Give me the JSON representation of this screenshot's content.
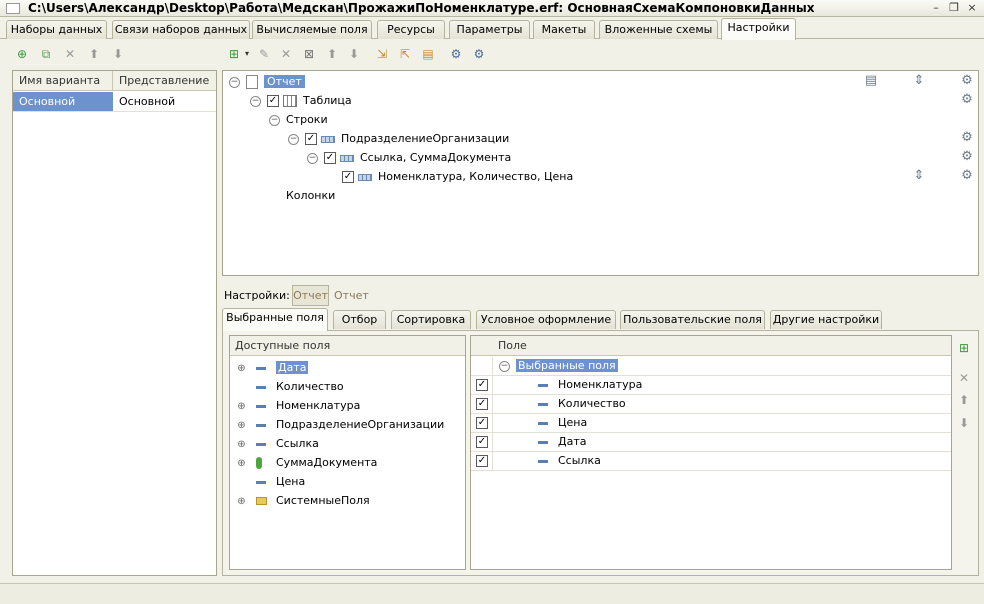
{
  "window": {
    "title": "C:\\Users\\Александр\\Desktop\\Работа\\Медскан\\ПрожажиПоНоменклатуре.erf: ОсновнаяСхемаКомпоновкиДанных",
    "minimize": "–",
    "restore": "❐",
    "close": "×"
  },
  "tabs": [
    "Наборы данных",
    "Связи наборов данных",
    "Вычисляемые поля",
    "Ресурсы",
    "Параметры",
    "Макеты",
    "Вложенные схемы",
    "Настройки"
  ],
  "active_tab": "Настройки",
  "variants": {
    "columns": [
      "Имя варианта",
      "Представление"
    ],
    "rows": [
      [
        "Основной",
        "Основной"
      ]
    ]
  },
  "structure": {
    "root": "Отчет",
    "table": "Таблица",
    "rows_label": "Строки",
    "groups": [
      "ПодразделениеОрганизации",
      "Ссылка, СуммаДокумента",
      "Номенклатура, Количество, Цена"
    ],
    "columns_label": "Колонки"
  },
  "settings_bar": {
    "label": "Настройки:",
    "button": "Отчет",
    "value": "Отчет"
  },
  "bottom_tabs": [
    "Выбранные поля",
    "Отбор",
    "Сортировка",
    "Условное оформление",
    "Пользовательские поля",
    "Другие настройки"
  ],
  "available_fields": {
    "header": "Доступные поля",
    "items": [
      "Дата",
      "Количество",
      "Номенклатура",
      "ПодразделениеОрганизации",
      "Ссылка",
      "СуммаДокумента",
      "Цена",
      "СистемныеПоля"
    ]
  },
  "selected_fields": {
    "header": "Поле",
    "group": "Выбранные поля",
    "items": [
      "Номенклатура",
      "Количество",
      "Цена",
      "Дата",
      "Ссылка"
    ]
  },
  "colors": {
    "selection": "#6c93d0",
    "window_bg": "#f2f1e7",
    "border": "#a8a58f"
  }
}
